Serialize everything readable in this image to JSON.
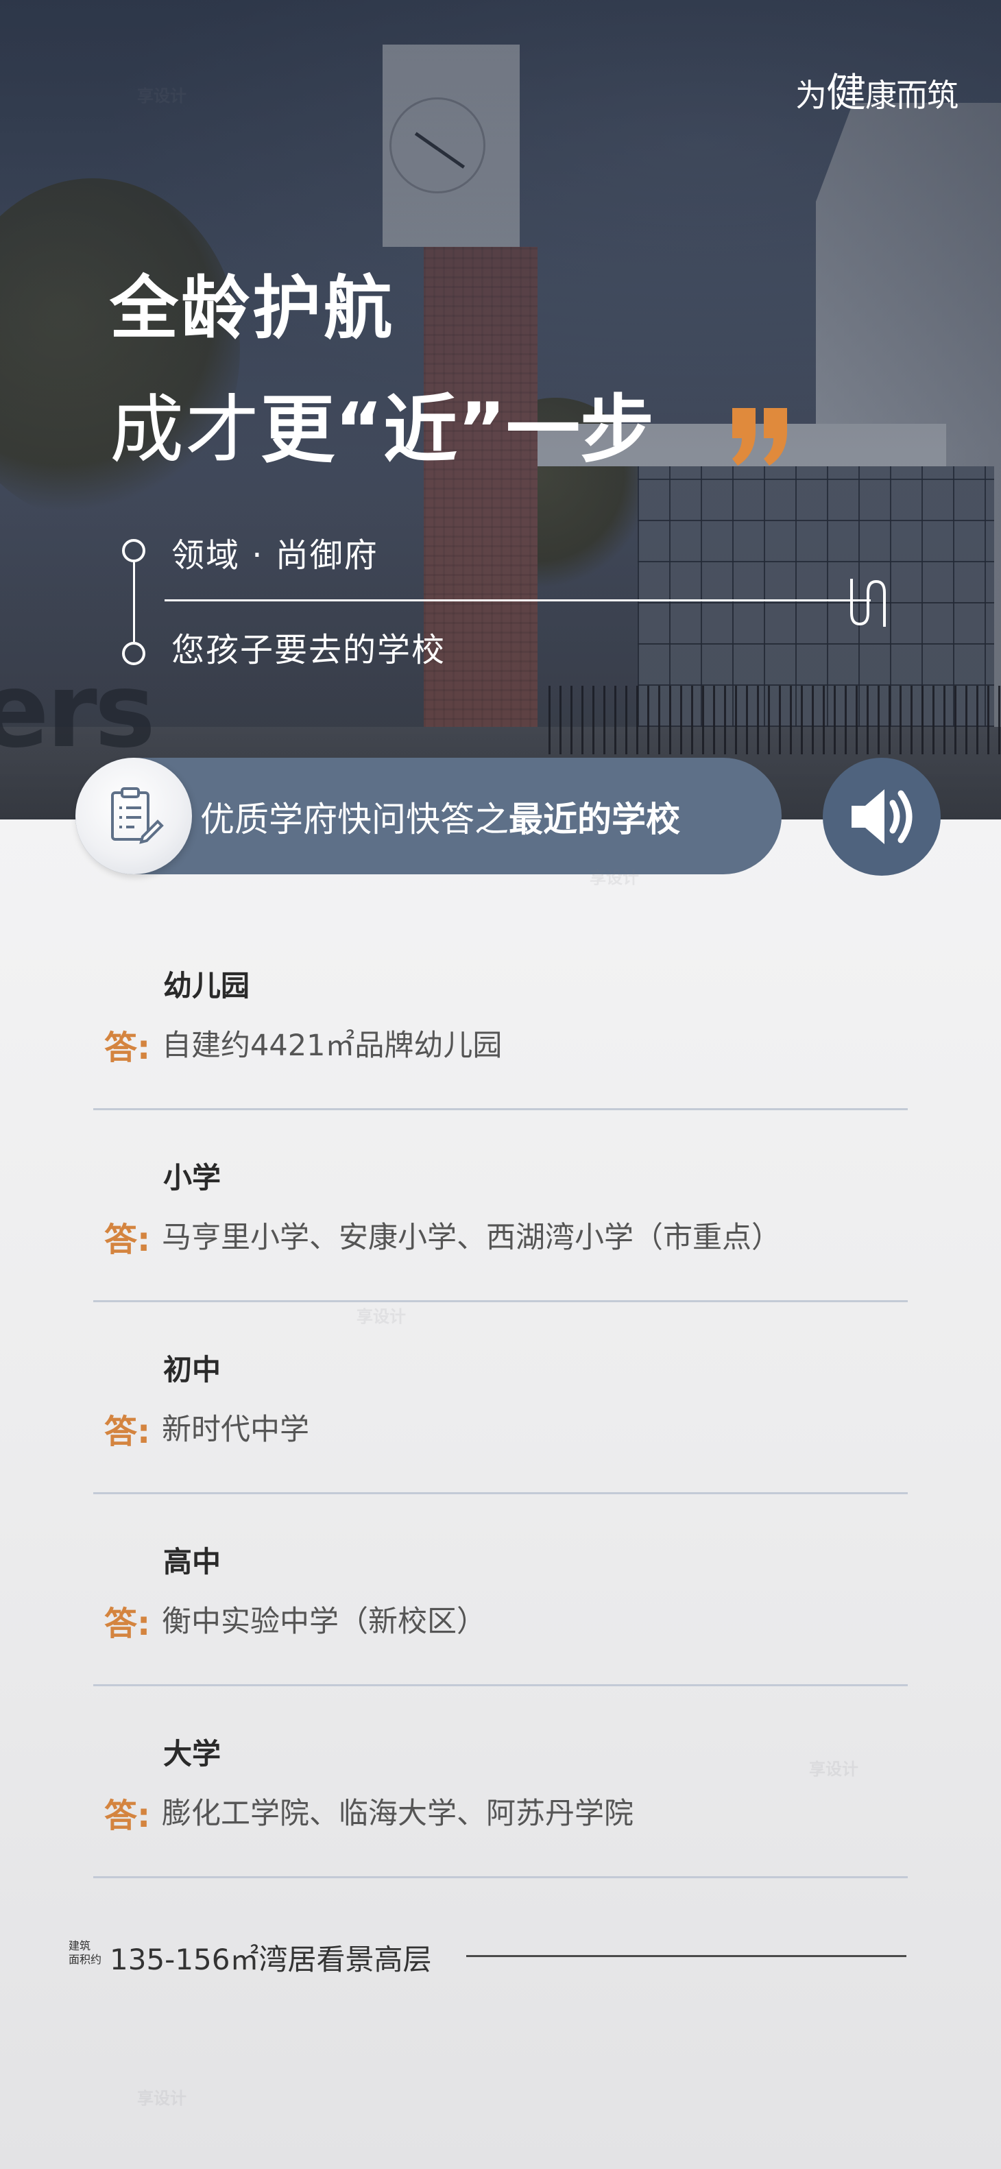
{
  "hero": {
    "slogan_prefix": "为",
    "slogan_big": "健",
    "slogan_suffix": "康而筑",
    "title_line1": "全龄护航",
    "title_line2_thin": "成才",
    "title_line2_bold": "更“近”一步",
    "sign_text": "ers",
    "project_name": "领域 · 尚御府",
    "tagline": "您孩子要去的学校"
  },
  "banner": {
    "text_regular": "优质学府快问快答之",
    "text_bold": "最近的学校",
    "clipboard_icon": "clipboard-icon",
    "speaker_icon": "speaker-icon"
  },
  "faq": {
    "answer_label": "答:",
    "items": [
      {
        "question": "幼儿园",
        "answer": "自建约4421㎡品牌幼儿园"
      },
      {
        "question": "小学",
        "answer": "马亨里小学、安康小学、西湖湾小学（市重点）"
      },
      {
        "question": "初中",
        "answer": "新时代中学"
      },
      {
        "question": "高中",
        "answer": "衡中实验中学（新校区）"
      },
      {
        "question": "大学",
        "answer": "膨化工学院、临海大学、阿苏丹学院"
      }
    ]
  },
  "footer": {
    "small_line1": "建筑",
    "small_line2": "面积约",
    "main": "135-156㎡湾居看景高层"
  },
  "watermark": "享设计",
  "colors": {
    "accent_orange": "#d4843f",
    "banner_blue": "#5e7088",
    "speaker_blue": "#4f637e",
    "divider": "#c3cad6"
  }
}
